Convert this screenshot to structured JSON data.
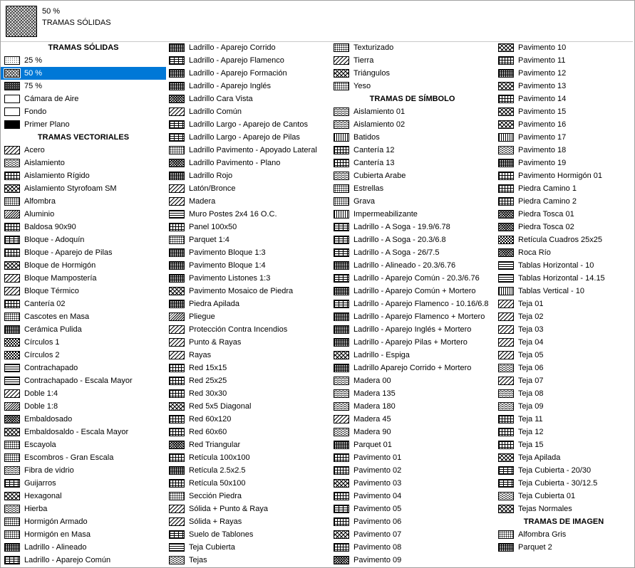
{
  "current": {
    "percent": "50 %",
    "name": "TRAMAS SÓLIDAS"
  },
  "columns": [
    [
      {
        "h": "TRAMAS SÓLIDAS"
      },
      {
        "t": "25 %",
        "p": "solid25"
      },
      {
        "t": "50 %",
        "p": "solid50",
        "sel": true
      },
      {
        "t": "75 %",
        "p": "solid75"
      },
      {
        "t": "Cámara de Aire",
        "p": "empty"
      },
      {
        "t": "Fondo",
        "p": "empty"
      },
      {
        "t": "Primer Plano",
        "p": "fill"
      },
      {
        "h": "TRAMAS VECTORIALES"
      },
      {
        "t": "Acero",
        "p": "diag"
      },
      {
        "t": "Aislamiento",
        "p": "wave"
      },
      {
        "t": "Aislamiento Rígido",
        "p": "grid"
      },
      {
        "t": "Aislamiento Styrofoam SM",
        "p": "cross"
      },
      {
        "t": "Alfombra",
        "p": "dots"
      },
      {
        "t": "Aluminio",
        "p": "diagdense"
      },
      {
        "t": "Baldosa 90x90",
        "p": "grid"
      },
      {
        "t": "Bloque - Adoquín",
        "p": "brick"
      },
      {
        "t": "Bloque - Aparejo de Pilas",
        "p": "grid"
      },
      {
        "t": "Bloque de Hormigón",
        "p": "cross"
      },
      {
        "t": "Bloque Mampostería",
        "p": "diag"
      },
      {
        "t": "Bloque Térmico",
        "p": "diag"
      },
      {
        "t": "Cantería 02",
        "p": "grid"
      },
      {
        "t": "Cascotes en Masa",
        "p": "dots"
      },
      {
        "t": "Cerámica Pulida",
        "p": "griddense"
      },
      {
        "t": "Círculos 1",
        "p": "checker"
      },
      {
        "t": "Círculos 2",
        "p": "checker"
      },
      {
        "t": "Contrachapado",
        "p": "hlines"
      },
      {
        "t": "Contrachapado - Escala Mayor",
        "p": "hlines"
      },
      {
        "t": "Doble 1:4",
        "p": "diag"
      },
      {
        "t": "Doble 1:8",
        "p": "diagdense"
      },
      {
        "t": "Embaldosado",
        "p": "crossdense"
      },
      {
        "t": "Embaldosaldo - Escala Mayor",
        "p": "cross"
      },
      {
        "t": "Escayola",
        "p": "dots"
      },
      {
        "t": "Escombros - Gran Escala",
        "p": "dots"
      },
      {
        "t": "Fibra de vidrio",
        "p": "wave"
      },
      {
        "t": "Guijarros",
        "p": "brick"
      },
      {
        "t": "Hexagonal",
        "p": "cross"
      },
      {
        "t": "Hierba",
        "p": "wave"
      },
      {
        "t": "Hormigón Armado",
        "p": "dots"
      },
      {
        "t": "Hormigón en Masa",
        "p": "dots"
      },
      {
        "t": "Ladrillo - Alineado",
        "p": "griddense"
      },
      {
        "t": "Ladrillo - Aparejo Común",
        "p": "brick"
      }
    ],
    [
      {
        "t": "Ladrillo - Aparejo Corrido",
        "p": "griddense"
      },
      {
        "t": "Ladrillo - Aparejo Flamenco",
        "p": "brick"
      },
      {
        "t": "Ladrillo - Aparejo Formación",
        "p": "griddense"
      },
      {
        "t": "Ladrillo - Aparejo Inglés",
        "p": "griddense"
      },
      {
        "t": "Ladrillo Cara Vista",
        "p": "crossdense"
      },
      {
        "t": "Ladrillo Común",
        "p": "diag"
      },
      {
        "t": "Ladrillo Largo - Aparejo de Cantos",
        "p": "brick"
      },
      {
        "t": "Ladrillo Largo - Aparejo de Pilas",
        "p": "brick"
      },
      {
        "t": "Ladrillo Pavimento - Apoyado Lateral",
        "p": "dots"
      },
      {
        "t": "Ladrillo Pavimento - Plano",
        "p": "crossdense"
      },
      {
        "t": "Ladrillo Rojo",
        "p": "griddense"
      },
      {
        "t": "Latón/Bronce",
        "p": "diag"
      },
      {
        "t": "Madera",
        "p": "diag"
      },
      {
        "t": "Muro Postes 2x4 16 O.C.",
        "p": "hlines"
      },
      {
        "t": "Panel 100x50",
        "p": "grid"
      },
      {
        "t": "Parquet 1:4",
        "p": "dots"
      },
      {
        "t": "Pavimento Bloque 1:3",
        "p": "griddense"
      },
      {
        "t": "Pavimento Bloque 1:4",
        "p": "griddense"
      },
      {
        "t": "Pavimento Listones 1:3",
        "p": "griddense"
      },
      {
        "t": "Pavimento Mosaico de Piedra",
        "p": "cross"
      },
      {
        "t": "Piedra Apilada",
        "p": "griddense"
      },
      {
        "t": "Pliegue",
        "p": "diagdense"
      },
      {
        "t": "Protección Contra Incendios",
        "p": "diag"
      },
      {
        "t": "Punto & Rayas",
        "p": "diag"
      },
      {
        "t": "Rayas",
        "p": "diag"
      },
      {
        "t": "Red 15x15",
        "p": "grid"
      },
      {
        "t": "Red 25x25",
        "p": "grid"
      },
      {
        "t": "Red 30x30",
        "p": "grid"
      },
      {
        "t": "Red 5x5 Diagonal",
        "p": "cross"
      },
      {
        "t": "Red 60x120",
        "p": "grid"
      },
      {
        "t": "Red 60x60",
        "p": "grid"
      },
      {
        "t": "Red Triangular",
        "p": "crossdense"
      },
      {
        "t": "Retícula 100x100",
        "p": "grid"
      },
      {
        "t": "Retícula 2.5x2.5",
        "p": "griddense"
      },
      {
        "t": "Retícula 50x100",
        "p": "grid"
      },
      {
        "t": "Sección Piedra",
        "p": "dots"
      },
      {
        "t": "Sólida + Punto & Raya",
        "p": "diag"
      },
      {
        "t": "Sólida + Rayas",
        "p": "diag"
      },
      {
        "t": "Suelo de Tablones",
        "p": "brick"
      },
      {
        "t": "Teja Cubierta",
        "p": "hlines"
      },
      {
        "t": "Tejas",
        "p": "wave"
      }
    ],
    [
      {
        "t": "Texturizado",
        "p": "dots"
      },
      {
        "t": "Tierra",
        "p": "diag"
      },
      {
        "t": "Triángulos",
        "p": "cross"
      },
      {
        "t": "Yeso",
        "p": "dots"
      },
      {
        "h": "TRAMAS DE SÍMBOLO"
      },
      {
        "t": "Aislamiento 01",
        "p": "wave"
      },
      {
        "t": "Aislamiento 02",
        "p": "wave"
      },
      {
        "t": "Batidos",
        "p": "vlines"
      },
      {
        "t": "Cantería 12",
        "p": "grid"
      },
      {
        "t": "Cantería 13",
        "p": "grid"
      },
      {
        "t": "Cubierta Arabe",
        "p": "wave"
      },
      {
        "t": "Estrellas",
        "p": "dots"
      },
      {
        "t": "Grava",
        "p": "dots"
      },
      {
        "t": "Impermeabilizante",
        "p": "vlines"
      },
      {
        "t": "Ladrillo - A Soga - 19.9/6.78",
        "p": "brick"
      },
      {
        "t": "Ladrillo - A Soga - 20.3/6.8",
        "p": "brick"
      },
      {
        "t": "Ladrillo - A Soga - 26/7.5",
        "p": "brick"
      },
      {
        "t": "Ladrillo - Alineado - 20.3/6.76",
        "p": "griddense"
      },
      {
        "t": "Ladrillo - Aparejo Común - 20.3/6.76",
        "p": "brick"
      },
      {
        "t": "Ladrillo - Aparejo Común + Mortero",
        "p": "griddense"
      },
      {
        "t": "Ladrillo - Aparejo Flamenco - 10.16/6.8",
        "p": "brick"
      },
      {
        "t": "Ladrillo - Aparejo Flamenco + Mortero",
        "p": "griddense"
      },
      {
        "t": "Ladrillo - Aparejo Inglés + Mortero",
        "p": "griddense"
      },
      {
        "t": "Ladrillo - Aparejo Pilas + Mortero",
        "p": "griddense"
      },
      {
        "t": "Ladrillo - Espiga",
        "p": "cross"
      },
      {
        "t": "Ladrillo Aparejo Corrido + Mortero",
        "p": "griddense"
      },
      {
        "t": "Madera 00",
        "p": "wave"
      },
      {
        "t": "Madera 135",
        "p": "wave"
      },
      {
        "t": "Madera 180",
        "p": "wave"
      },
      {
        "t": "Madera 45",
        "p": "diag"
      },
      {
        "t": "Madera 90",
        "p": "wave"
      },
      {
        "t": "Parquet 01",
        "p": "griddense"
      },
      {
        "t": "Pavimento 01",
        "p": "grid"
      },
      {
        "t": "Pavimento 02",
        "p": "grid"
      },
      {
        "t": "Pavimento 03",
        "p": "cross"
      },
      {
        "t": "Pavimento 04",
        "p": "grid"
      },
      {
        "t": "Pavimento 05",
        "p": "brick"
      },
      {
        "t": "Pavimento 06",
        "p": "grid"
      },
      {
        "t": "Pavimento 07",
        "p": "cross"
      },
      {
        "t": "Pavimento 08",
        "p": "grid"
      },
      {
        "t": "Pavimento 09",
        "p": "crossdense"
      }
    ],
    [
      {
        "t": "Pavimento 10",
        "p": "cross"
      },
      {
        "t": "Pavimento 11",
        "p": "grid"
      },
      {
        "t": "Pavimento 12",
        "p": "griddense"
      },
      {
        "t": "Pavimento 13",
        "p": "cross"
      },
      {
        "t": "Pavimento 14",
        "p": "grid"
      },
      {
        "t": "Pavimento 15",
        "p": "cross"
      },
      {
        "t": "Pavimento 16",
        "p": "cross"
      },
      {
        "t": "Pavimento 17",
        "p": "vlines"
      },
      {
        "t": "Pavimento 18",
        "p": "wave"
      },
      {
        "t": "Pavimento 19",
        "p": "griddense"
      },
      {
        "t": "Pavimento Hormigón 01",
        "p": "grid"
      },
      {
        "t": "Piedra Camino 1",
        "p": "grid"
      },
      {
        "t": "Piedra Camino 2",
        "p": "grid"
      },
      {
        "t": "Piedra Tosca 01",
        "p": "crossdense"
      },
      {
        "t": "Piedra Tosca 02",
        "p": "crossdense"
      },
      {
        "t": "Retícula Cuadros 25x25",
        "p": "checker"
      },
      {
        "t": "Roca Río",
        "p": "crossdense"
      },
      {
        "t": "Tablas Horizontal - 10",
        "p": "hlines"
      },
      {
        "t": "Tablas Horizontal - 14.15",
        "p": "hlines"
      },
      {
        "t": "Tablas Vertical - 10",
        "p": "vlines"
      },
      {
        "t": "Teja 01",
        "p": "diag"
      },
      {
        "t": "Teja 02",
        "p": "diag"
      },
      {
        "t": "Teja 03",
        "p": "diag"
      },
      {
        "t": "Teja 04",
        "p": "diag"
      },
      {
        "t": "Teja 05",
        "p": "diag"
      },
      {
        "t": "Teja 06",
        "p": "wave"
      },
      {
        "t": "Teja 07",
        "p": "diag"
      },
      {
        "t": "Teja 08",
        "p": "wave"
      },
      {
        "t": "Teja 09",
        "p": "wave"
      },
      {
        "t": "Teja 11",
        "p": "grid"
      },
      {
        "t": "Teja 12",
        "p": "grid"
      },
      {
        "t": "Teja 15",
        "p": "grid"
      },
      {
        "t": "Teja Apilada",
        "p": "cross"
      },
      {
        "t": "Teja Cubierta - 20/30",
        "p": "brick"
      },
      {
        "t": "Teja Cubierta - 30/12.5",
        "p": "brick"
      },
      {
        "t": "Teja Cubierta 01",
        "p": "wave"
      },
      {
        "t": "Tejas Normales",
        "p": "cross"
      },
      {
        "h": "TRAMAS DE IMAGEN"
      },
      {
        "t": "Alfombra Gris",
        "p": "dots"
      },
      {
        "t": "Parquet 2",
        "p": "griddense"
      }
    ]
  ]
}
